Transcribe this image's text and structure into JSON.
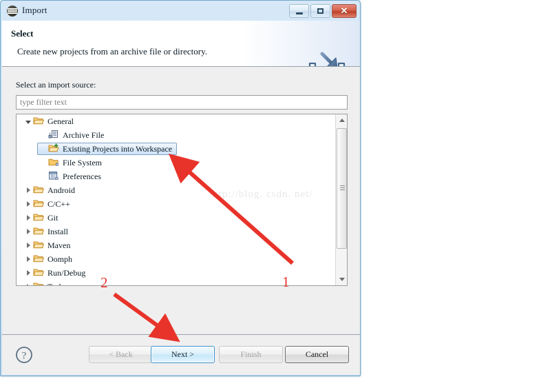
{
  "window": {
    "title": "Import",
    "icon": "eclipse-logo-icon",
    "controls": {
      "minimize": "minimize-button",
      "maximize": "maximize-button",
      "close_glyph": "✕"
    }
  },
  "header": {
    "title": "Select",
    "description": "Create new projects from an archive file or directory.",
    "icon": "import-arrow-into-tray-icon"
  },
  "body": {
    "source_label": "Select an import source:",
    "filter": {
      "placeholder": "type filter text",
      "value": ""
    },
    "tree": [
      {
        "label": "General",
        "indent": 0,
        "twisty": "open",
        "icon": "open-folder-icon",
        "selected": false
      },
      {
        "label": "Archive File",
        "indent": 1,
        "twisty": "none",
        "icon": "archive-file-icon",
        "selected": false
      },
      {
        "label": "Existing Projects into Workspace",
        "indent": 1,
        "twisty": "none",
        "icon": "existing-projects-icon",
        "selected": true
      },
      {
        "label": "File System",
        "indent": 1,
        "twisty": "none",
        "icon": "file-system-folder-icon",
        "selected": false
      },
      {
        "label": "Preferences",
        "indent": 1,
        "twisty": "none",
        "icon": "preferences-icon",
        "selected": false
      },
      {
        "label": "Android",
        "indent": 0,
        "twisty": "closed",
        "icon": "open-folder-icon",
        "selected": false
      },
      {
        "label": "C/C++",
        "indent": 0,
        "twisty": "closed",
        "icon": "open-folder-icon",
        "selected": false
      },
      {
        "label": "Git",
        "indent": 0,
        "twisty": "closed",
        "icon": "open-folder-icon",
        "selected": false
      },
      {
        "label": "Install",
        "indent": 0,
        "twisty": "closed",
        "icon": "open-folder-icon",
        "selected": false
      },
      {
        "label": "Maven",
        "indent": 0,
        "twisty": "closed",
        "icon": "open-folder-icon",
        "selected": false
      },
      {
        "label": "Oomph",
        "indent": 0,
        "twisty": "closed",
        "icon": "open-folder-icon",
        "selected": false
      },
      {
        "label": "Run/Debug",
        "indent": 0,
        "twisty": "closed",
        "icon": "open-folder-icon",
        "selected": false
      },
      {
        "label": "Tasks",
        "indent": 0,
        "twisty": "closed",
        "icon": "open-folder-icon",
        "selected": false
      }
    ],
    "scrollbar": {
      "up_arrow": "scroll-up-arrow-icon",
      "down_arrow": "scroll-down-arrow-icon"
    }
  },
  "buttons": {
    "help": "?",
    "back": "< Back",
    "next": "Next >",
    "finish": "Finish",
    "cancel": "Cancel"
  },
  "annotations": {
    "one": "1",
    "two": "2",
    "arrow_color": "#e8332a"
  },
  "watermark": {
    "text": "http://blog. csdn. net/"
  }
}
